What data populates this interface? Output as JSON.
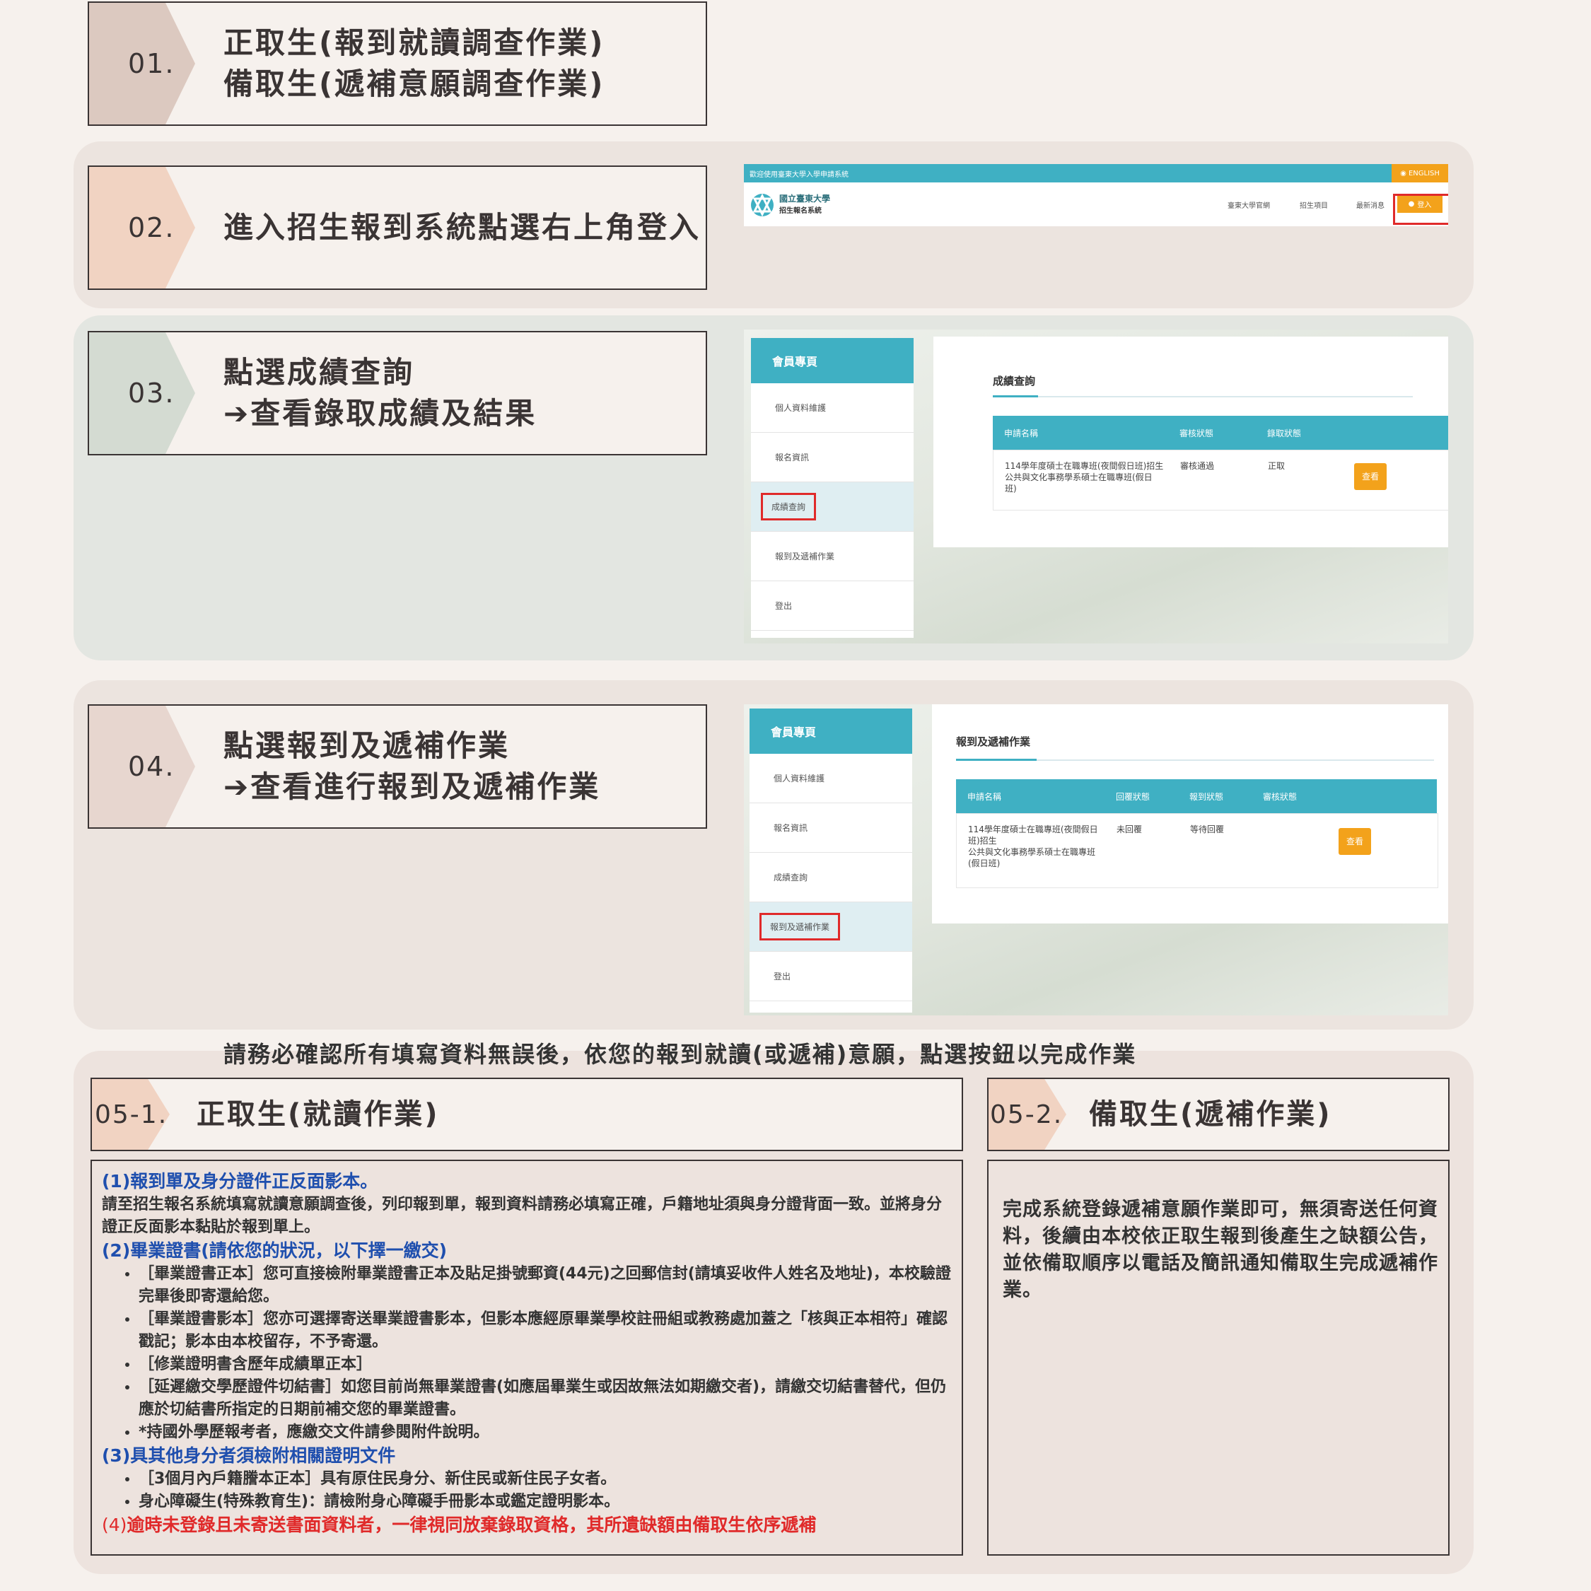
{
  "step1": {
    "num": "01.",
    "line1": "正取生(報到就讀調查作業)",
    "line2": "備取生(遞補意願調查作業)"
  },
  "step2": {
    "num": "02.",
    "line1": "進入招生報到系統點選右上角登入"
  },
  "step3": {
    "num": "03.",
    "line1": "點選成績查詢",
    "line2": "➔查看錄取成績及結果"
  },
  "step4": {
    "num": "04.",
    "line1": "點選報到及遞補作業",
    "line2": "➔查看進行報到及遞補作業"
  },
  "login_screen": {
    "welcome": "歡迎使用臺東大學入學申請系統",
    "english": "◉ ENGLISH",
    "logo_line1": "國立臺東大學",
    "logo_line2": "招生報名系統",
    "nav": [
      "臺東大學官網",
      "招生項目",
      "最新消息"
    ],
    "login": "登入"
  },
  "portal_menu": {
    "header": "會員專頁",
    "items": [
      "個人資料維護",
      "報名資訊",
      "成績查詢",
      "報到及遞補作業",
      "登出"
    ]
  },
  "grades_screen": {
    "title": "成績查詢",
    "headers": [
      "申請名稱",
      "審核狀態",
      "錄取狀態"
    ],
    "row_name": [
      "114學年度碩士在職專班(夜間假日班)招生",
      "公共與文化事務學系碩士在職專班(假日",
      "班)"
    ],
    "row_review": "審核通過",
    "row_admit": "正取",
    "view": "查看"
  },
  "report_screen": {
    "title": "報到及遞補作業",
    "headers": [
      "申請名稱",
      "回覆狀態",
      "報到狀態",
      "審核狀態"
    ],
    "row_name": [
      "114學年度碩士在職專班(夜間假日",
      "班)招生",
      "公共與文化事務學系碩士在職專班",
      "(假日班)"
    ],
    "row_reply": "未回覆",
    "row_report": "等待回覆",
    "view": "查看"
  },
  "instruction": "請務必確認所有填寫資料無誤後，依您的報到就讀(或遞補)意願，點選按鈕以完成作業",
  "step5_1": {
    "num": "05-1.",
    "title": "正取生(就讀作業)",
    "h1": "(1)報到單及身分證件正反面影本。",
    "p1": "請至招生報名系統填寫就讀意願調查後，列印報到單，報到資料請務必填寫正確，戶籍地址須與身分證背面一致。並將身分證正反面影本黏貼於報到單上。",
    "h2": "(2)畢業證書(請依您的狀況，以下擇一繳交)",
    "list2": [
      "［畢業證書正本］您可直接檢附畢業證書正本及貼足掛號郵資(44元)之回郵信封(請填妥收件人姓名及地址)，本校驗證完畢後即寄還給您。",
      "［畢業證書影本］您亦可選擇寄送畢業證書影本，但影本應經原畢業學校註冊組或教務處加蓋之「核與正本相符」確認戳記；影本由本校留存，不予寄還。",
      "［修業證明書含歷年成績單正本］",
      "［延遲繳交學歷證件切結書］如您目前尚無畢業證書(如應屆畢業生或因故無法如期繳交者)，請繳交切結書替代，但仍應於切結書所指定的日期前補交您的畢業證書。",
      "*持國外學歷報考者，應繳交文件請參閱附件說明。"
    ],
    "h3": "(3)具其他身分者須檢附相關證明文件",
    "list3": [
      "［3個月內戶籍謄本正本］具有原住民身分、新住民或新住民子女者。",
      "身心障礙生(特殊教育生)：請檢附身心障礙手冊影本或鑑定證明影本。"
    ],
    "h4_prefix": "(4)",
    "h4": "逾時未登錄且未寄送書面資料者，一律視同放棄錄取資格，其所遺缺額由備取生依序遞補"
  },
  "step5_2": {
    "num": "05-2.",
    "title": "備取生(遞補作業)",
    "body": "完成系統登錄遞補意願作業即可，無須寄送任何資料，後續由本校依正取生報到後產生之缺額公告，並依備取順序以電話及簡訊通知備取生完成遞補作業。"
  },
  "colors": {
    "teal": "#3fb0c3",
    "orange": "#f3a21b",
    "red": "#e02a2a",
    "blue": "#1f4fae",
    "chev1": "#dcc9c0",
    "chev2": "#f1d3c2",
    "chev3": "#d4dbd2",
    "chev4": "#e7d6cf"
  }
}
